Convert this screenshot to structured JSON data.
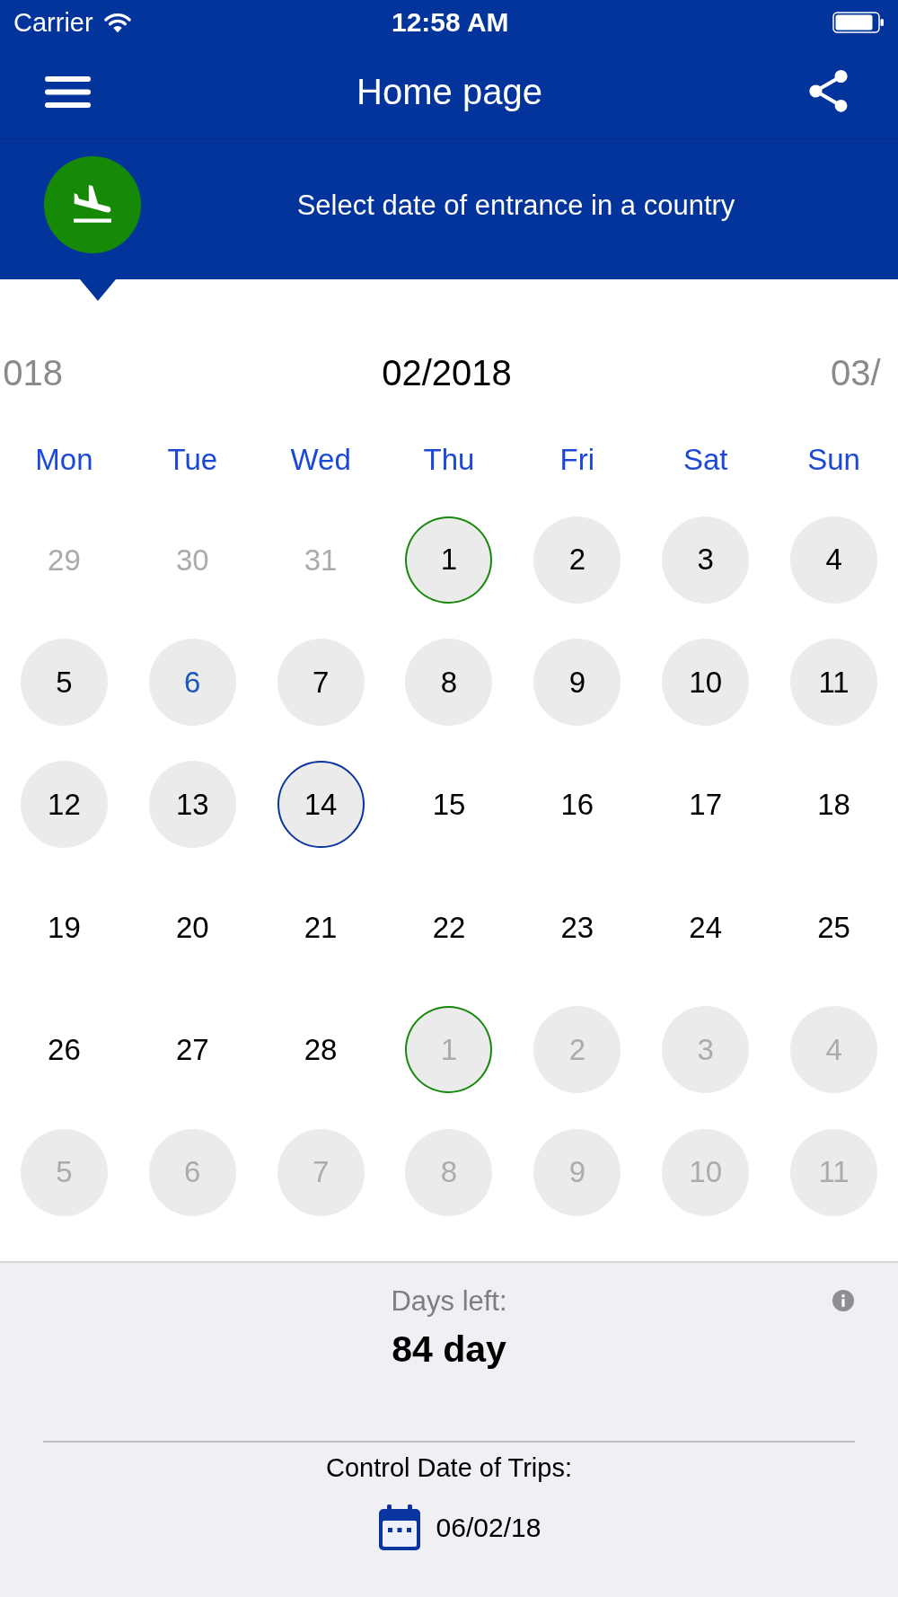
{
  "status_bar": {
    "carrier": "Carrier",
    "time": "12:58 AM"
  },
  "nav": {
    "title": "Home page"
  },
  "banner": {
    "text": "Select date of entrance in a country"
  },
  "calendar": {
    "previous_month": "018",
    "month": "02/2018",
    "next_month": "03/",
    "weekdays": [
      "Mon",
      "Tue",
      "Wed",
      "Thu",
      "Fri",
      "Sat",
      "Sun"
    ],
    "weeks": [
      [
        {
          "label": "29",
          "other_month": true,
          "in_range": false,
          "today": false,
          "selected": false,
          "marked": false
        },
        {
          "label": "30",
          "other_month": true,
          "in_range": false,
          "today": false,
          "selected": false,
          "marked": false
        },
        {
          "label": "31",
          "other_month": true,
          "in_range": false,
          "today": false,
          "selected": false,
          "marked": false
        },
        {
          "label": "1",
          "other_month": false,
          "in_range": true,
          "today": false,
          "selected": false,
          "marked": true
        },
        {
          "label": "2",
          "other_month": false,
          "in_range": true,
          "today": false,
          "selected": false,
          "marked": false
        },
        {
          "label": "3",
          "other_month": false,
          "in_range": true,
          "today": false,
          "selected": false,
          "marked": false
        },
        {
          "label": "4",
          "other_month": false,
          "in_range": true,
          "today": false,
          "selected": false,
          "marked": false
        }
      ],
      [
        {
          "label": "5",
          "other_month": false,
          "in_range": true,
          "today": false,
          "selected": false,
          "marked": false
        },
        {
          "label": "6",
          "other_month": false,
          "in_range": true,
          "today": true,
          "selected": false,
          "marked": false
        },
        {
          "label": "7",
          "other_month": false,
          "in_range": true,
          "today": false,
          "selected": false,
          "marked": false
        },
        {
          "label": "8",
          "other_month": false,
          "in_range": true,
          "today": false,
          "selected": false,
          "marked": false
        },
        {
          "label": "9",
          "other_month": false,
          "in_range": true,
          "today": false,
          "selected": false,
          "marked": false
        },
        {
          "label": "10",
          "other_month": false,
          "in_range": true,
          "today": false,
          "selected": false,
          "marked": false
        },
        {
          "label": "11",
          "other_month": false,
          "in_range": true,
          "today": false,
          "selected": false,
          "marked": false
        }
      ],
      [
        {
          "label": "12",
          "other_month": false,
          "in_range": true,
          "today": false,
          "selected": false,
          "marked": false
        },
        {
          "label": "13",
          "other_month": false,
          "in_range": true,
          "today": false,
          "selected": false,
          "marked": false
        },
        {
          "label": "14",
          "other_month": false,
          "in_range": true,
          "today": false,
          "selected": true,
          "marked": false
        },
        {
          "label": "15",
          "other_month": false,
          "in_range": false,
          "today": false,
          "selected": false,
          "marked": false
        },
        {
          "label": "16",
          "other_month": false,
          "in_range": false,
          "today": false,
          "selected": false,
          "marked": false
        },
        {
          "label": "17",
          "other_month": false,
          "in_range": false,
          "today": false,
          "selected": false,
          "marked": false
        },
        {
          "label": "18",
          "other_month": false,
          "in_range": false,
          "today": false,
          "selected": false,
          "marked": false
        }
      ],
      [
        {
          "label": "19",
          "other_month": false,
          "in_range": false,
          "today": false,
          "selected": false,
          "marked": false
        },
        {
          "label": "20",
          "other_month": false,
          "in_range": false,
          "today": false,
          "selected": false,
          "marked": false
        },
        {
          "label": "21",
          "other_month": false,
          "in_range": false,
          "today": false,
          "selected": false,
          "marked": false
        },
        {
          "label": "22",
          "other_month": false,
          "in_range": false,
          "today": false,
          "selected": false,
          "marked": false
        },
        {
          "label": "23",
          "other_month": false,
          "in_range": false,
          "today": false,
          "selected": false,
          "marked": false
        },
        {
          "label": "24",
          "other_month": false,
          "in_range": false,
          "today": false,
          "selected": false,
          "marked": false
        },
        {
          "label": "25",
          "other_month": false,
          "in_range": false,
          "today": false,
          "selected": false,
          "marked": false
        }
      ],
      [
        {
          "label": "26",
          "other_month": false,
          "in_range": false,
          "today": false,
          "selected": false,
          "marked": false
        },
        {
          "label": "27",
          "other_month": false,
          "in_range": false,
          "today": false,
          "selected": false,
          "marked": false
        },
        {
          "label": "28",
          "other_month": false,
          "in_range": false,
          "today": false,
          "selected": false,
          "marked": false
        },
        {
          "label": "1",
          "other_month": true,
          "in_range": true,
          "today": false,
          "selected": false,
          "marked": true
        },
        {
          "label": "2",
          "other_month": true,
          "in_range": true,
          "today": false,
          "selected": false,
          "marked": false
        },
        {
          "label": "3",
          "other_month": true,
          "in_range": true,
          "today": false,
          "selected": false,
          "marked": false
        },
        {
          "label": "4",
          "other_month": true,
          "in_range": true,
          "today": false,
          "selected": false,
          "marked": false
        }
      ],
      [
        {
          "label": "5",
          "other_month": true,
          "in_range": true,
          "today": false,
          "selected": false,
          "marked": false
        },
        {
          "label": "6",
          "other_month": true,
          "in_range": true,
          "today": false,
          "selected": false,
          "marked": false
        },
        {
          "label": "7",
          "other_month": true,
          "in_range": true,
          "today": false,
          "selected": false,
          "marked": false
        },
        {
          "label": "8",
          "other_month": true,
          "in_range": true,
          "today": false,
          "selected": false,
          "marked": false
        },
        {
          "label": "9",
          "other_month": true,
          "in_range": true,
          "today": false,
          "selected": false,
          "marked": false
        },
        {
          "label": "10",
          "other_month": true,
          "in_range": true,
          "today": false,
          "selected": false,
          "marked": false
        },
        {
          "label": "11",
          "other_month": true,
          "in_range": true,
          "today": false,
          "selected": false,
          "marked": false
        }
      ]
    ]
  },
  "summary": {
    "label": "Days left:",
    "value": "84 day",
    "control_label": "Control Date of Trips:",
    "control_date": "06/02/18"
  }
}
